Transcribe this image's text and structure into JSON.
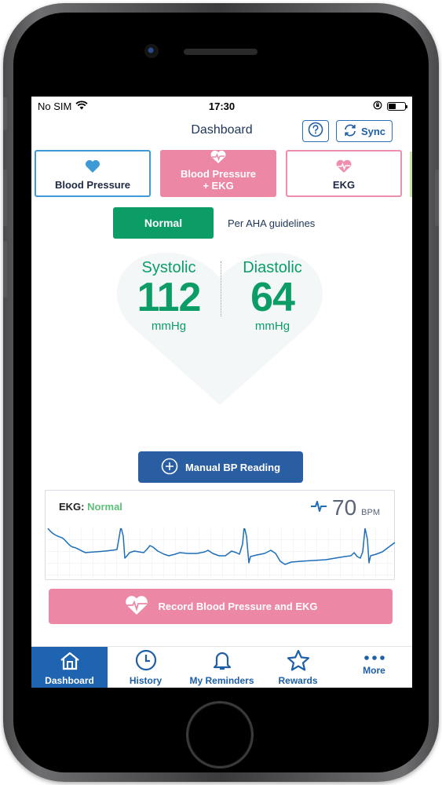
{
  "status_bar": {
    "carrier": "No SIM",
    "time": "17:30",
    "battery_level": 0.45
  },
  "nav": {
    "title": "Dashboard",
    "help_icon": "question-circle-icon",
    "sync_label": "Sync",
    "sync_icon": "refresh-icon"
  },
  "modes": [
    {
      "label": "Blood Pressure",
      "icon": "heart-icon",
      "selected": false
    },
    {
      "label_line1": "Blood Pressure",
      "label_line2": "+ EKG",
      "icon": "heart-pulse-icon",
      "selected": true
    },
    {
      "label": "EKG",
      "icon": "heart-pulse-icon",
      "selected": false
    }
  ],
  "classification": {
    "status": "Normal",
    "note": "Per AHA guidelines"
  },
  "reading": {
    "systolic_label": "Systolic",
    "systolic_value": "112",
    "diastolic_label": "Diastolic",
    "diastolic_value": "64",
    "unit": "mmHg"
  },
  "manual_button": {
    "label": "Manual BP Reading",
    "icon": "plus-circle-icon"
  },
  "ekg": {
    "label": "EKG:",
    "status": "Normal",
    "heart_rate": "70",
    "heart_rate_unit": "BPM",
    "icon": "pulse-icon"
  },
  "record_button": {
    "label": "Record Blood Pressure and EKG",
    "icon": "heart-pulse-icon"
  },
  "tabs": [
    {
      "label": "Dashboard",
      "icon": "home-icon",
      "active": true
    },
    {
      "label": "History",
      "icon": "clock-icon",
      "active": false
    },
    {
      "label": "My Reminders",
      "icon": "bell-icon",
      "active": false
    },
    {
      "label": "Rewards",
      "icon": "star-icon",
      "active": false
    },
    {
      "label": "More",
      "icon": "more-dots-icon",
      "active": false
    }
  ],
  "colors": {
    "primary_blue": "#1f64b0",
    "normal_green": "#0c9d67",
    "ekg_pink": "#ec88a6",
    "bp_blue": "#3d9ad6"
  }
}
